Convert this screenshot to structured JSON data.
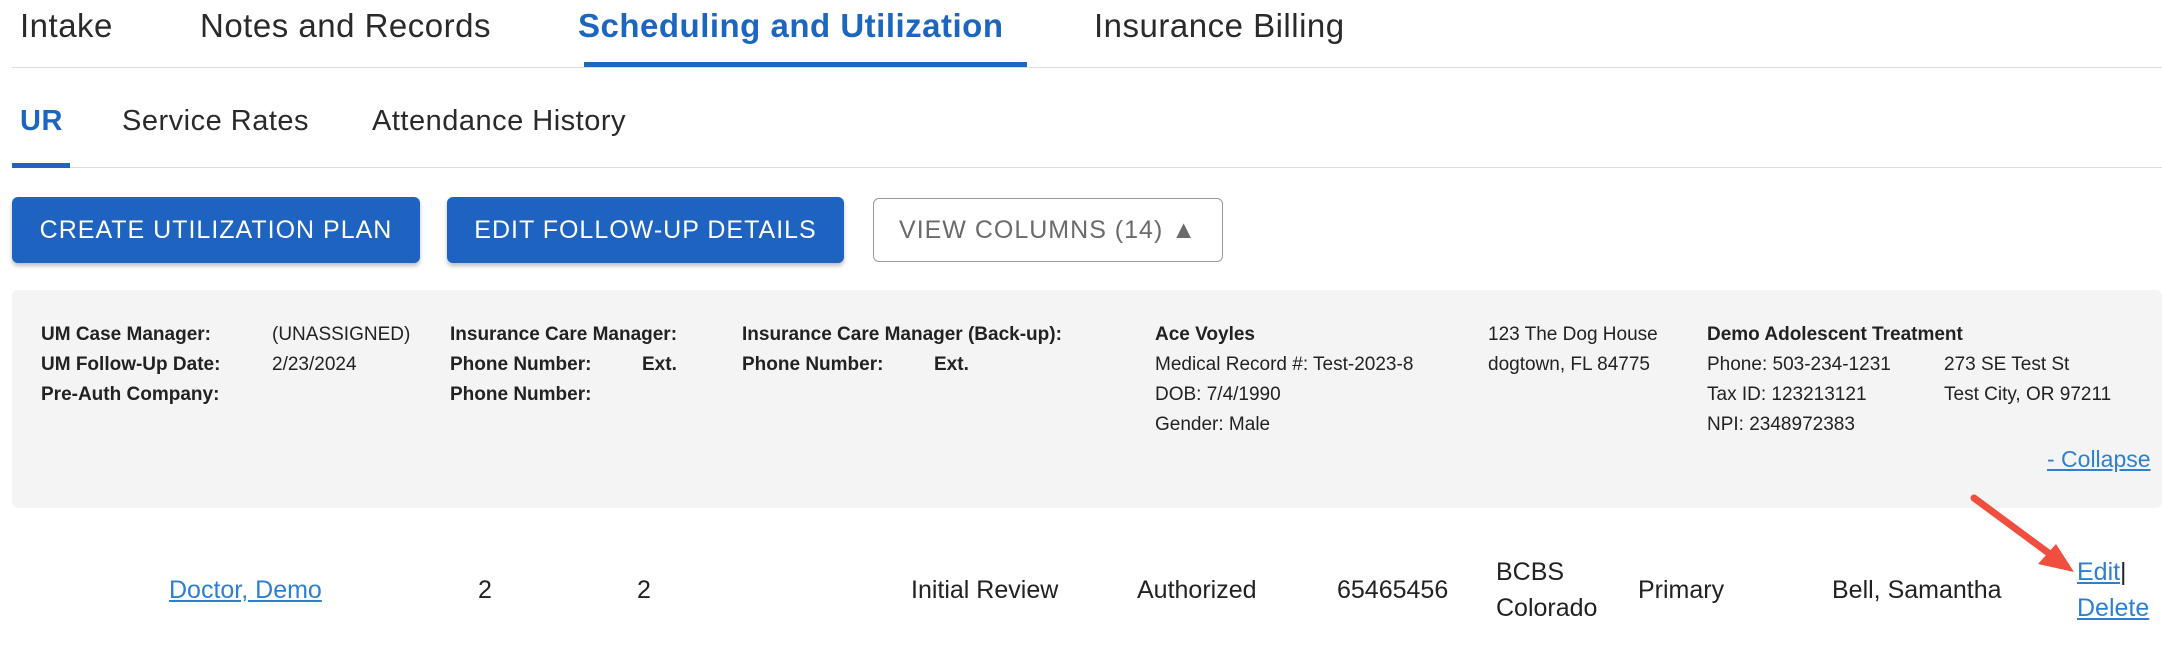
{
  "main_tabs": [
    {
      "label": "Intake"
    },
    {
      "label": "Notes and Records"
    },
    {
      "label": "Scheduling and Utilization"
    },
    {
      "label": "Insurance Billing"
    }
  ],
  "sub_tabs": [
    {
      "label": "UR"
    },
    {
      "label": "Service Rates"
    },
    {
      "label": "Attendance History"
    }
  ],
  "toolbar": {
    "create_label": "CREATE UTILIZATION PLAN",
    "edit_followup_label": "EDIT FOLLOW-UP DETAILS",
    "view_columns_label": "VIEW COLUMNS (14) ▲"
  },
  "summary": {
    "um_case_manager_label": "UM Case Manager:",
    "um_case_manager_value": "(UNASSIGNED)",
    "um_followup_label": "UM Follow-Up Date:",
    "um_followup_value": "2/23/2024",
    "preauth_label": "Pre-Auth Company:",
    "icm_label": "Insurance Care Manager:",
    "icm_phone_label": "Phone Number:",
    "icm_ext_label": "Ext.",
    "icm_phone2_label": "Phone Number:",
    "icm_backup_label": "Insurance Care Manager (Back-up):",
    "icm_backup_phone_label": "Phone Number:",
    "icm_backup_ext_label": "Ext.",
    "patient_name": "Ace Voyles",
    "patient_mrn": "Medical Record #: Test-2023-8",
    "patient_dob": "DOB: 7/4/1990",
    "patient_gender": "Gender: Male",
    "patient_address1": "123 The Dog House",
    "patient_address2": "dogtown, FL 84775",
    "facility_name": "Demo Adolescent Treatment",
    "facility_phone": "Phone: 503-234-1231",
    "facility_tax": "Tax ID: 123213121",
    "facility_npi": "NPI: 2348972383",
    "facility_address1": "273 SE Test St",
    "facility_address2": "Test City, OR 97211",
    "collapse_label": "- Collapse"
  },
  "row": {
    "provider": "Doctor, Demo",
    "col2": "2",
    "col3": "2",
    "review_type": "Initial Review",
    "status": "Authorized",
    "auth_number": "65465456",
    "payer_line1": "BCBS",
    "payer_line2": "Colorado",
    "priority": "Primary",
    "reviewer": "Bell, Samantha",
    "edit_label": "Edit",
    "separator": "|",
    "delete_label": "Delete"
  },
  "colors": {
    "accent": "#1d66c0",
    "link": "#2f7fd1",
    "annotation_arrow": "#f04e3e"
  }
}
